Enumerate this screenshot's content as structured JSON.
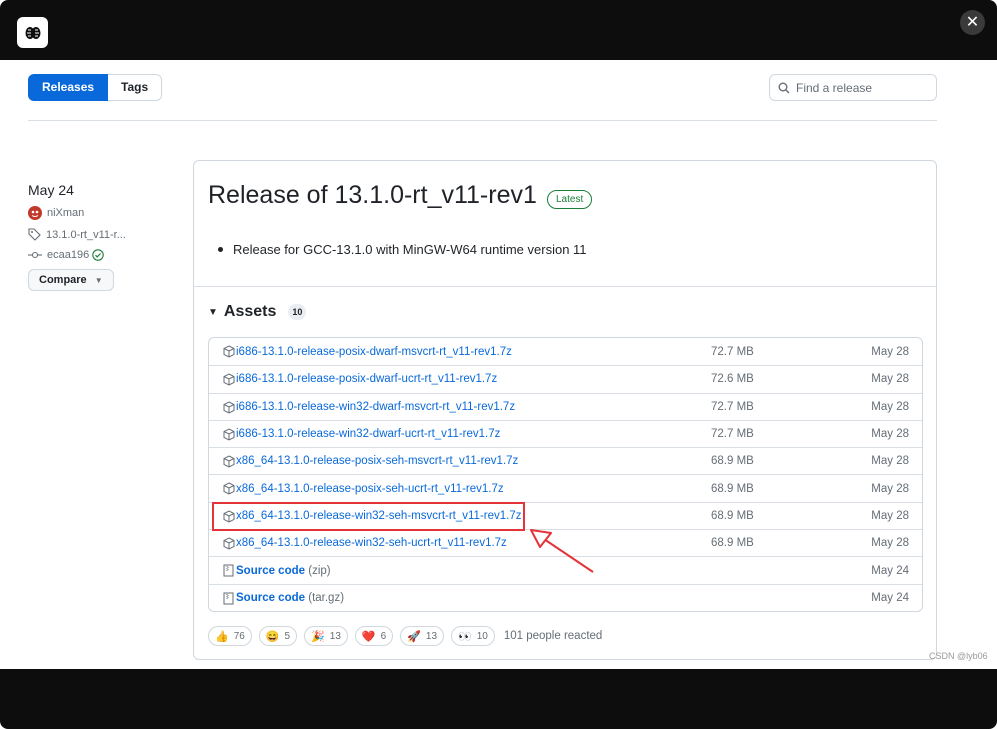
{
  "window": {
    "close_label": "✕"
  },
  "tabs": [
    {
      "label": "Releases"
    },
    {
      "label": "Tags"
    }
  ],
  "search": {
    "placeholder": "Find a release"
  },
  "sidebar": {
    "date": "May 24",
    "author": "niXman",
    "tag": "13.1.0-rt_v11-r...",
    "commit": "ecaa196",
    "compare_label": "Compare"
  },
  "release": {
    "title": "Release of 13.1.0-rt_v11-rev1",
    "badge": "Latest",
    "notes": [
      "Release for GCC-13.1.0 with MinGW-W64 runtime version 11"
    ]
  },
  "assets": {
    "heading": "Assets",
    "count": "10",
    "items": [
      {
        "name": "i686-13.1.0-release-posix-dwarf-msvcrt-rt_v11-rev1.7z",
        "suffix": "",
        "size": "72.7 MB",
        "date": "May 28"
      },
      {
        "name": "i686-13.1.0-release-posix-dwarf-ucrt-rt_v11-rev1.7z",
        "suffix": "",
        "size": "72.6 MB",
        "date": "May 28"
      },
      {
        "name": "i686-13.1.0-release-win32-dwarf-msvcrt-rt_v11-rev1.7z",
        "suffix": "",
        "size": "72.7 MB",
        "date": "May 28"
      },
      {
        "name": "i686-13.1.0-release-win32-dwarf-ucrt-rt_v11-rev1.7z",
        "suffix": "",
        "size": "72.7 MB",
        "date": "May 28"
      },
      {
        "name": "x86_64-13.1.0-release-posix-seh-msvcrt-rt_v11-rev1.7z",
        "suffix": "",
        "size": "68.9 MB",
        "date": "May 28"
      },
      {
        "name": "x86_64-13.1.0-release-posix-seh-ucrt-rt_v11-rev1.7z",
        "suffix": "",
        "size": "68.9 MB",
        "date": "May 28"
      },
      {
        "name": "x86_64-13.1.0-release-win32-seh-msvcrt-rt_v11-rev1.7z",
        "suffix": "",
        "size": "68.9 MB",
        "date": "May 28"
      },
      {
        "name": "x86_64-13.1.0-release-win32-seh-ucrt-rt_v11-rev1.7z",
        "suffix": "",
        "size": "68.9 MB",
        "date": "May 28"
      },
      {
        "name": "Source code",
        "suffix": "(zip)",
        "size": "",
        "date": "May 24"
      },
      {
        "name": "Source code",
        "suffix": "(tar.gz)",
        "size": "",
        "date": "May 24"
      }
    ]
  },
  "reactions": {
    "items": [
      {
        "emoji": "👍",
        "count": "76"
      },
      {
        "emoji": "😄",
        "count": "5"
      },
      {
        "emoji": "🎉",
        "count": "13"
      },
      {
        "emoji": "❤️",
        "count": "6"
      },
      {
        "emoji": "🚀",
        "count": "13"
      },
      {
        "emoji": "👀",
        "count": "10"
      }
    ],
    "summary": "101 people reacted"
  },
  "watermark": "CSDN @lyb06",
  "colors": {
    "accent": "#0969da",
    "highlight": "#e5333a",
    "badge": "#1a7f37"
  }
}
